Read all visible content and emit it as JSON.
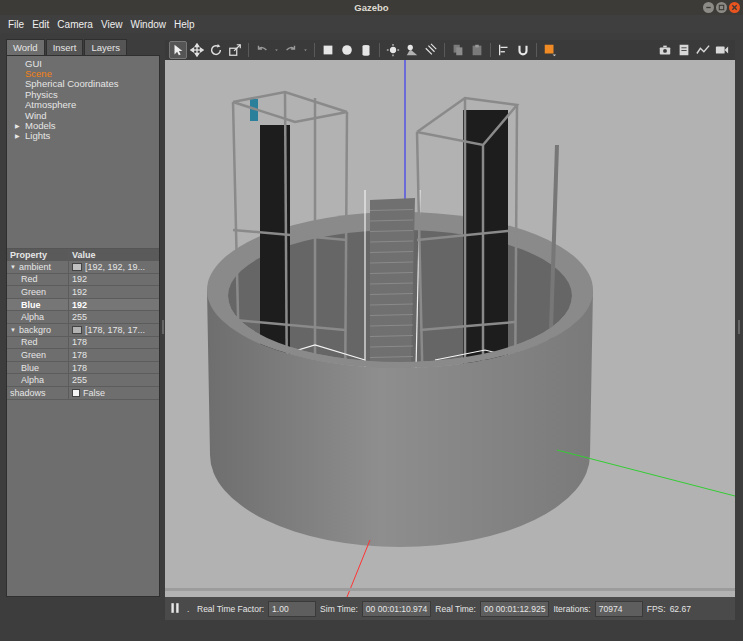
{
  "window": {
    "title": "Gazebo",
    "controls": [
      {
        "kind": "minimize"
      },
      {
        "kind": "maximize"
      },
      {
        "kind": "close"
      }
    ]
  },
  "menu": [
    "File",
    "Edit",
    "Camera",
    "View",
    "Window",
    "Help"
  ],
  "tabs": [
    {
      "label": "World",
      "selected": true
    },
    {
      "label": "Insert",
      "selected": false
    },
    {
      "label": "Layers",
      "selected": false
    }
  ],
  "tree": [
    {
      "label": "GUI",
      "selected": false,
      "expandable": false
    },
    {
      "label": "Scene",
      "selected": true,
      "expandable": false
    },
    {
      "label": "Spherical Coordinates",
      "selected": false,
      "expandable": false
    },
    {
      "label": "Physics",
      "selected": false,
      "expandable": false
    },
    {
      "label": "Atmosphere",
      "selected": false,
      "expandable": false
    },
    {
      "label": "Wind",
      "selected": false,
      "expandable": false
    },
    {
      "label": "Models",
      "selected": false,
      "expandable": true,
      "expanded": false,
      "arrow": "▶"
    },
    {
      "label": "Lights",
      "selected": false,
      "expandable": true,
      "expanded": false,
      "arrow": "▶"
    }
  ],
  "properties": {
    "columns": [
      "Property",
      "Value"
    ],
    "rows": [
      {
        "name": "ambient",
        "value": "[192, 192, 19...",
        "kind": "group",
        "expanded": true,
        "arrow": "▼",
        "color": "#c0c0c0",
        "selected": false
      },
      {
        "name": "Red",
        "value": "192",
        "kind": "field",
        "selected": false
      },
      {
        "name": "Green",
        "value": "192",
        "kind": "field",
        "selected": false
      },
      {
        "name": "Blue",
        "value": "192",
        "kind": "field",
        "selected": true
      },
      {
        "name": "Alpha",
        "value": "255",
        "kind": "field",
        "selected": false
      },
      {
        "name": "backgro",
        "value": "[178, 178, 17...",
        "kind": "group",
        "expanded": true,
        "arrow": "▼",
        "color": "#b2b2b2",
        "selected": false
      },
      {
        "name": "Red",
        "value": "178",
        "kind": "field",
        "selected": false
      },
      {
        "name": "Green",
        "value": "178",
        "kind": "field",
        "selected": false
      },
      {
        "name": "Blue",
        "value": "178",
        "kind": "field",
        "selected": false
      },
      {
        "name": "Alpha",
        "value": "255",
        "kind": "field",
        "selected": false
      },
      {
        "name": "shadows",
        "value": "False",
        "kind": "checkbox",
        "checked": false,
        "selected": false
      }
    ]
  },
  "toolbar": [
    {
      "kind": "select",
      "side": "left",
      "selected": true
    },
    {
      "kind": "translate",
      "side": "left",
      "selected": false
    },
    {
      "kind": "rotate",
      "side": "left",
      "selected": false
    },
    {
      "kind": "scale",
      "side": "left",
      "selected": false
    },
    {
      "kind": "separator",
      "side": "left",
      "selected": false
    },
    {
      "kind": "undo",
      "side": "left",
      "selected": false
    },
    {
      "kind": "dropdown",
      "side": "left",
      "selected": false
    },
    {
      "kind": "redo",
      "side": "left",
      "selected": false
    },
    {
      "kind": "dropdown",
      "side": "left",
      "selected": false
    },
    {
      "kind": "separator",
      "side": "left",
      "selected": false
    },
    {
      "kind": "box",
      "side": "left",
      "selected": false
    },
    {
      "kind": "sphere",
      "side": "left",
      "selected": false
    },
    {
      "kind": "cylinder",
      "side": "left",
      "selected": false
    },
    {
      "kind": "separator",
      "side": "left",
      "selected": false
    },
    {
      "kind": "point-light",
      "side": "left",
      "selected": false
    },
    {
      "kind": "spot-light",
      "side": "left",
      "selected": false
    },
    {
      "kind": "directional-light",
      "side": "left",
      "selected": false
    },
    {
      "kind": "separator",
      "side": "left",
      "selected": false
    },
    {
      "kind": "copy",
      "side": "left",
      "selected": false
    },
    {
      "kind": "paste",
      "side": "left",
      "selected": false
    },
    {
      "kind": "separator",
      "side": "left",
      "selected": false
    },
    {
      "kind": "align",
      "side": "left",
      "selected": false
    },
    {
      "kind": "snap",
      "side": "left",
      "selected": false
    },
    {
      "kind": "separator",
      "side": "left",
      "selected": false
    },
    {
      "kind": "view-angle",
      "side": "left",
      "selected": false
    },
    {
      "kind": "screenshot",
      "side": "right",
      "selected": false
    },
    {
      "kind": "log",
      "side": "right",
      "selected": false
    },
    {
      "kind": "plot",
      "side": "right",
      "selected": false
    },
    {
      "kind": "record",
      "side": "right",
      "selected": false
    }
  ],
  "status_bar": {
    "running": true,
    "step": ".",
    "items": [
      {
        "label": "Real Time Factor:",
        "value": "1.00",
        "boxed": true
      },
      {
        "label": "Sim Time:",
        "value": "00 00:01:10.974",
        "boxed": true
      },
      {
        "label": "Real Time:",
        "value": "00 00:01:12.925",
        "boxed": true
      },
      {
        "label": "Iterations:",
        "value": "70974",
        "boxed": true
      },
      {
        "label": "FPS:",
        "value": "62.67",
        "boxed": false
      }
    ]
  }
}
